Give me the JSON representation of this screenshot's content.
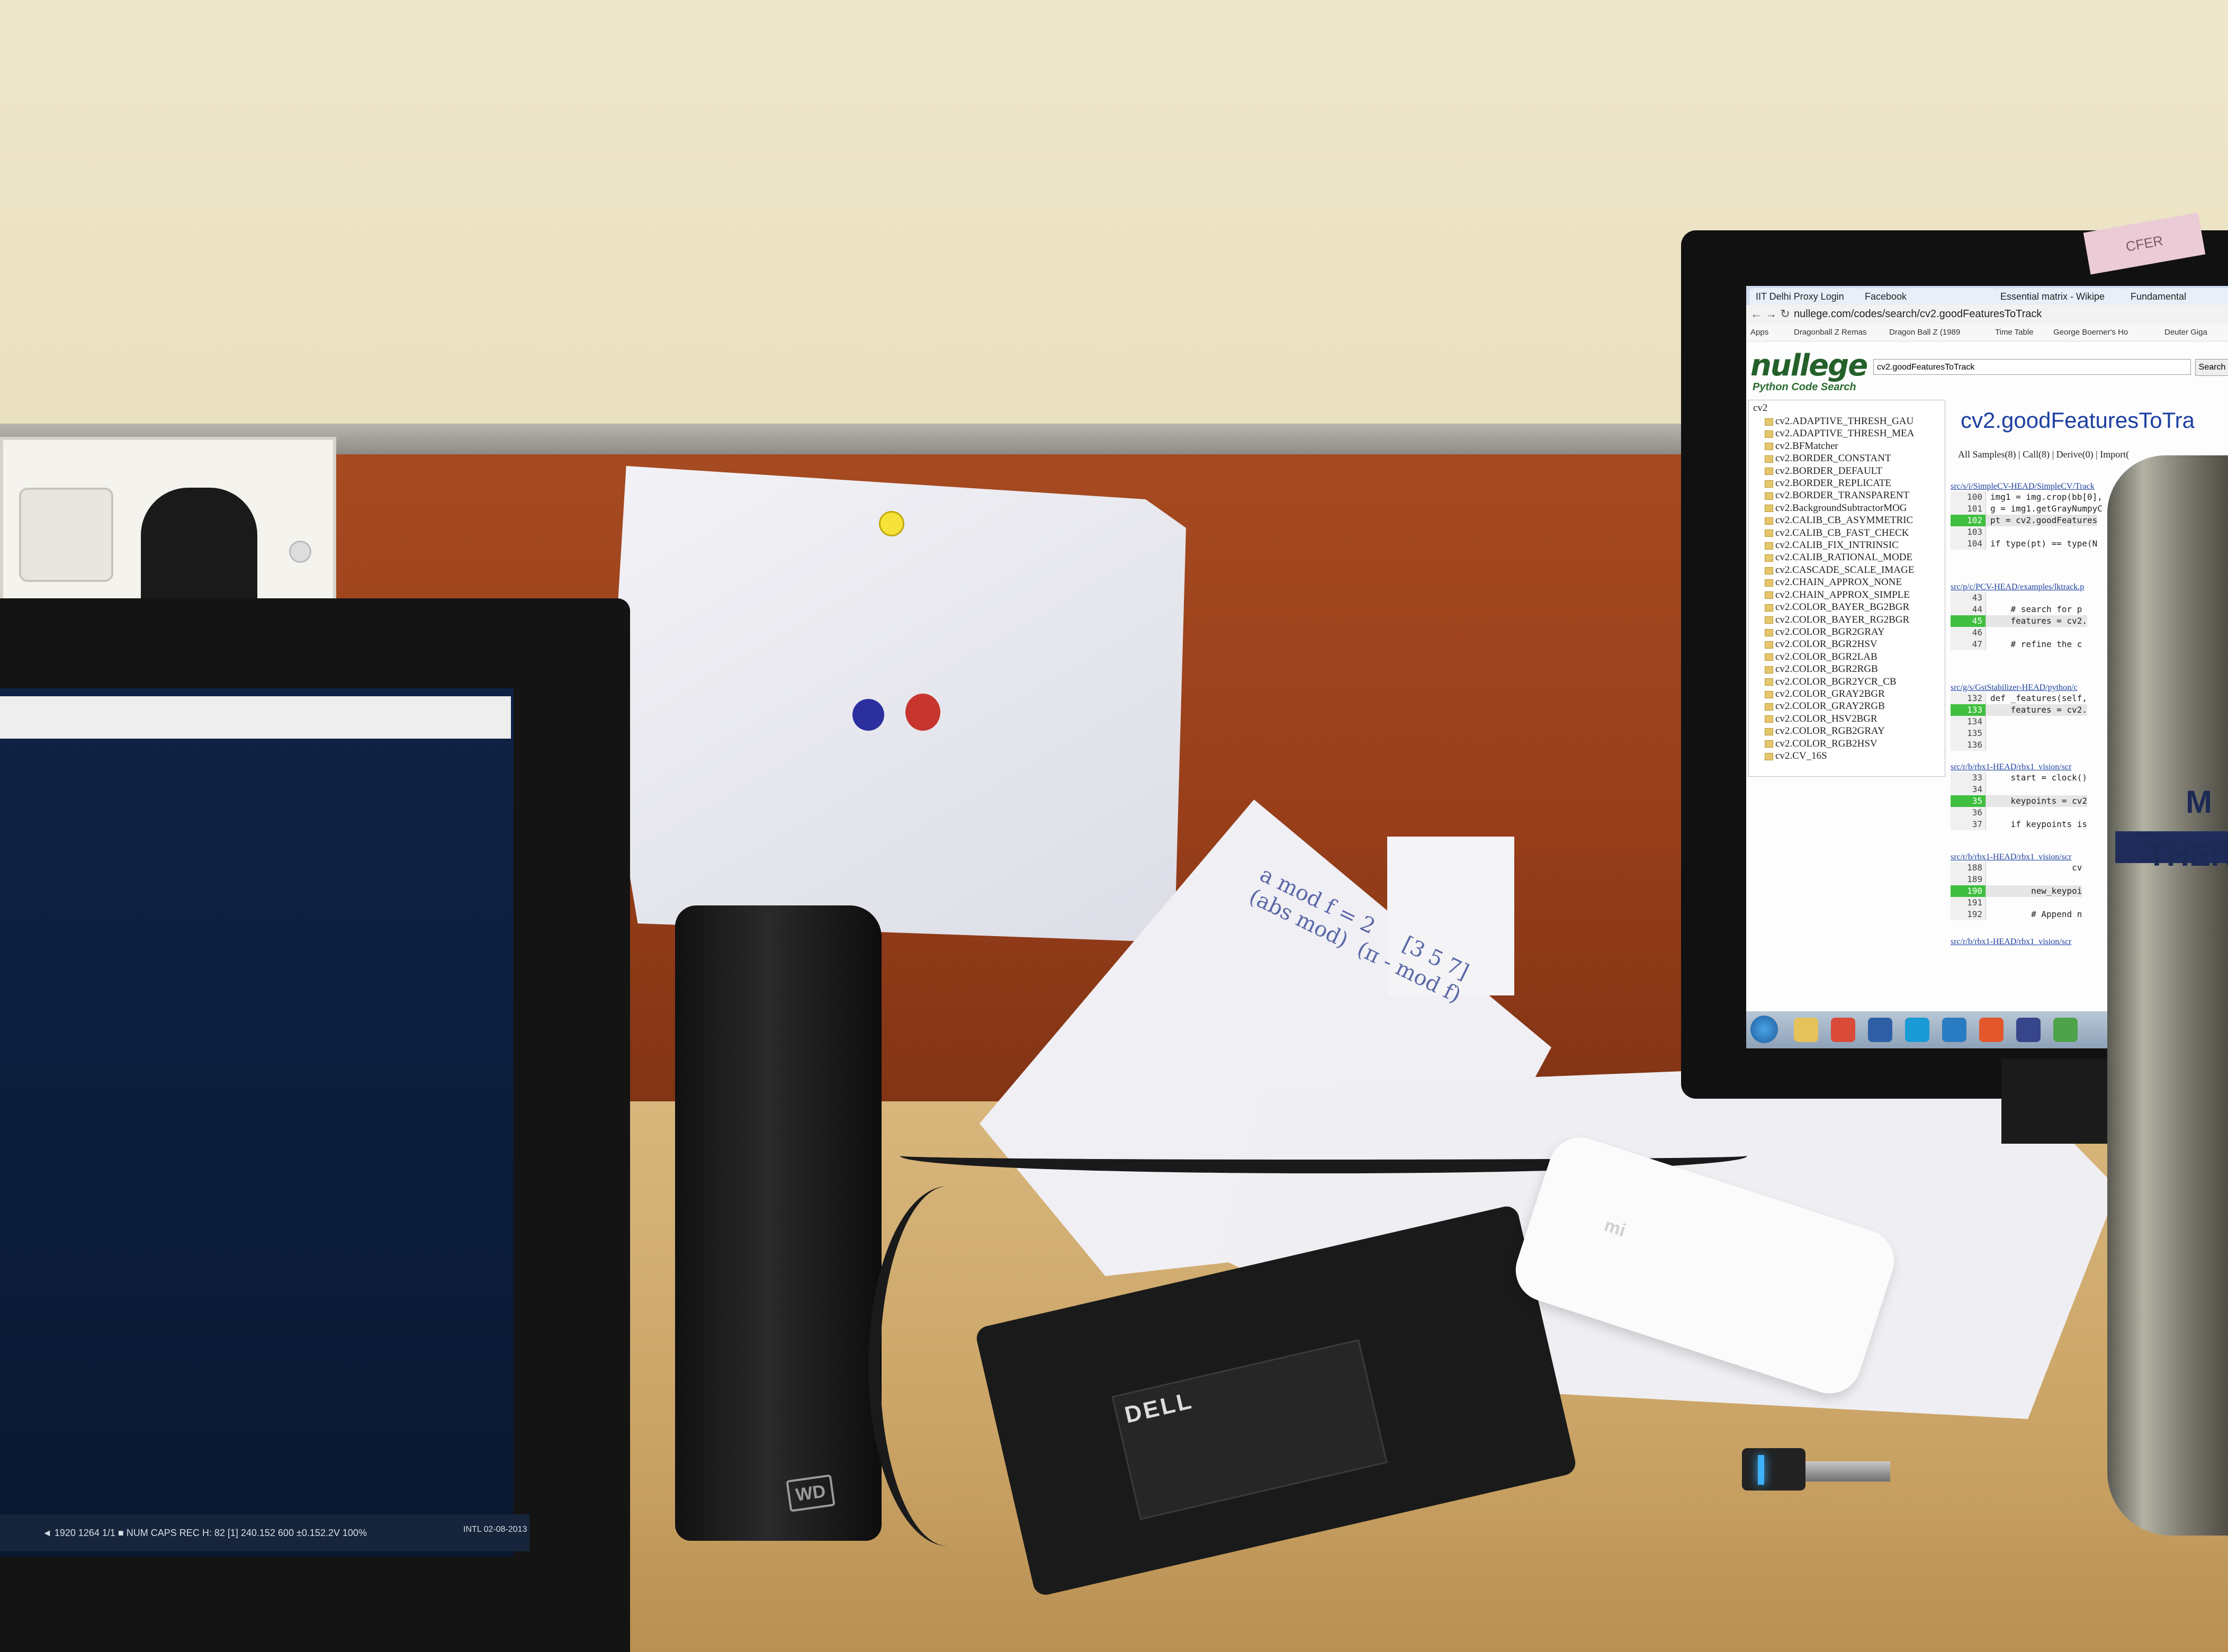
{
  "scene": {
    "description_tags": [
      "desk",
      "monitor",
      "laptop",
      "external hard drive",
      "power adapter",
      "phone",
      "flask"
    ]
  },
  "browser": {
    "tabs": [
      "IIT Delhi Proxy Login",
      "Facebook",
      "Essential matrix - Wikipe",
      "Fundamental"
    ],
    "url": "nullege.com/codes/search/cv2.goodFeaturesToTrack",
    "bookmarks": [
      "Apps",
      "Dragonball Z Remas",
      "Dragon Ball Z (1989",
      "Time Table",
      "George Boerner's Ho",
      "Deuter Giga"
    ],
    "logo": "nullege",
    "logo_sub": "Python Code Search",
    "search_value": "cv2.goodFeaturesToTrack",
    "search_button": "Search",
    "tree_root": "cv2",
    "tree_items": [
      "cv2.ADAPTIVE_THRESH_GAU",
      "cv2.ADAPTIVE_THRESH_MEA",
      "cv2.BFMatcher",
      "cv2.BORDER_CONSTANT",
      "cv2.BORDER_DEFAULT",
      "cv2.BORDER_REPLICATE",
      "cv2.BORDER_TRANSPARENT",
      "cv2.BackgroundSubtractorMOG",
      "cv2.CALIB_CB_ASYMMETRIC",
      "cv2.CALIB_CB_FAST_CHECK",
      "cv2.CALIB_FIX_INTRINSIC",
      "cv2.CALIB_RATIONAL_MODE",
      "cv2.CASCADE_SCALE_IMAGE",
      "cv2.CHAIN_APPROX_NONE",
      "cv2.CHAIN_APPROX_SIMPLE",
      "cv2.COLOR_BAYER_BG2BGR",
      "cv2.COLOR_BAYER_RG2BGR",
      "cv2.COLOR_BGR2GRAY",
      "cv2.COLOR_BGR2HSV",
      "cv2.COLOR_BGR2LAB",
      "cv2.COLOR_BGR2RGB",
      "cv2.COLOR_BGR2YCR_CB",
      "cv2.COLOR_GRAY2BGR",
      "cv2.COLOR_GRAY2RGB",
      "cv2.COLOR_HSV2BGR",
      "cv2.COLOR_RGB2GRAY",
      "cv2.COLOR_RGB2HSV",
      "cv2.CV_16S"
    ],
    "title": "cv2.goodFeaturesToTra",
    "links": "All Samples(8)  |  Call(8)  |  Derive(0)  |  Import(",
    "samples": [
      {
        "path": "src/s/i/SimpleCV-HEAD/SimpleCV/Track",
        "rows": [
          {
            "ln": "100",
            "code": "img1 = img.crop(bb[0],"
          },
          {
            "ln": "101",
            "code": "g = img1.getGrayNumpyC"
          },
          {
            "ln": "102",
            "code": "pt = cv2.goodFeatures",
            "hl": true
          },
          {
            "ln": "103",
            "code": ""
          },
          {
            "ln": "104",
            "code": "if type(pt) == type(N"
          }
        ]
      },
      {
        "path": "src/p/c/PCV-HEAD/examples/lktrack.p",
        "rows": [
          {
            "ln": "43",
            "code": ""
          },
          {
            "ln": "44",
            "code": "    # search for p"
          },
          {
            "ln": "45",
            "code": "    features = cv2.",
            "hl": true
          },
          {
            "ln": "46",
            "code": ""
          },
          {
            "ln": "47",
            "code": "    # refine the c"
          }
        ]
      },
      {
        "path": "src/g/s/GstStabilizer-HEAD/python/c",
        "rows": [
          {
            "ln": "132",
            "code": "def _features(self,"
          },
          {
            "ln": "133",
            "code": "    features = cv2.",
            "hl": true
          },
          {
            "ln": "134",
            "code": ""
          },
          {
            "ln": "135",
            "code": ""
          },
          {
            "ln": "136",
            "code": ""
          }
        ]
      },
      {
        "path": "src/r/b/rbx1-HEAD/rbx1_vision/scr",
        "rows": [
          {
            "ln": "33",
            "code": "    start = clock()"
          },
          {
            "ln": "34",
            "code": ""
          },
          {
            "ln": "35",
            "code": "    keypoints = cv2",
            "hl": true
          },
          {
            "ln": "36",
            "code": ""
          },
          {
            "ln": "37",
            "code": "    if keypoints is"
          }
        ]
      },
      {
        "path": "src/r/b/rbx1-HEAD/rbx1_vision/scr",
        "rows": [
          {
            "ln": "188",
            "code": "                cv"
          },
          {
            "ln": "189",
            "code": ""
          },
          {
            "ln": "190",
            "code": "        new_keypoi",
            "hl": true
          },
          {
            "ln": "191",
            "code": ""
          },
          {
            "ln": "192",
            "code": "        # Append n"
          }
        ]
      },
      {
        "path": "src/r/b/rbx1-HEAD/rbx1_vision/scr",
        "rows": []
      }
    ]
  },
  "laptop": {
    "taskbar_text": "◄ 1920 1264   1/1   ■   NUM   CAPS   REC   H: 82   [1] 240.152   600   ±0.152.2V   100%",
    "clock_date": "INTL   02-08-2013"
  },
  "hdd": {
    "logo": "WD"
  },
  "adapter": {
    "brand": "DELL"
  },
  "phone": {
    "logo": "mi"
  },
  "flask": {
    "label": "THER",
    "label_top": "M"
  },
  "sticky_note": {
    "text": "CFER"
  },
  "paper_math": "a mod f = 2     [3 5 7]\n(abs mod)  (π - mod f)"
}
